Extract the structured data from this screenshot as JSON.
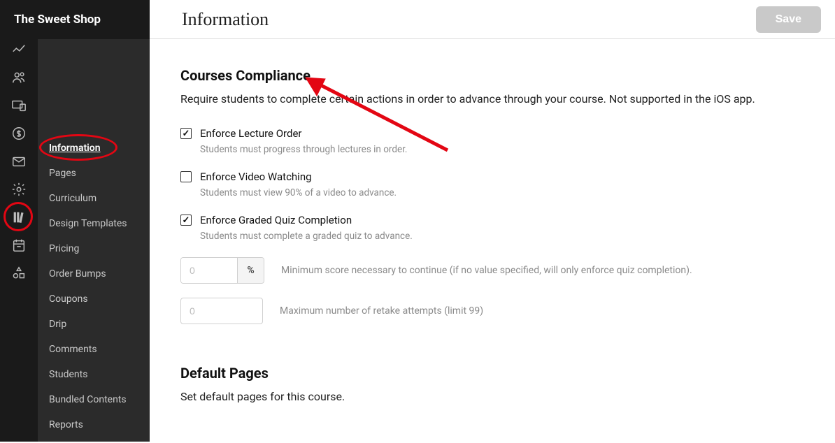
{
  "brand": "The Sweet Shop",
  "subnav": {
    "items": [
      {
        "label": "Information",
        "active": true
      },
      {
        "label": "Pages"
      },
      {
        "label": "Curriculum"
      },
      {
        "label": "Design Templates"
      },
      {
        "label": "Pricing"
      },
      {
        "label": "Order Bumps"
      },
      {
        "label": "Coupons"
      },
      {
        "label": "Drip"
      },
      {
        "label": "Comments"
      },
      {
        "label": "Students"
      },
      {
        "label": "Bundled Contents"
      },
      {
        "label": "Reports"
      }
    ]
  },
  "topbar": {
    "title": "Information",
    "save_label": "Save"
  },
  "compliance": {
    "title": "Courses Compliance",
    "desc": "Require students to complete certain actions in order to advance through your course. Not supported in the iOS app.",
    "items": [
      {
        "label": "Enforce Lecture Order",
        "help": "Students must progress through lectures in order.",
        "checked": true
      },
      {
        "label": "Enforce Video Watching",
        "help": "Students must view 90% of a video to advance.",
        "checked": false
      },
      {
        "label": "Enforce Graded Quiz Completion",
        "help": "Students must complete a graded quiz to advance.",
        "checked": true
      }
    ],
    "min_score": {
      "placeholder": "0",
      "suffix": "%",
      "help": "Minimum score necessary to continue (if no value specified, will only enforce quiz completion)."
    },
    "retakes": {
      "placeholder": "0",
      "help": "Maximum number of retake attempts (limit 99)"
    }
  },
  "default_pages": {
    "title": "Default Pages",
    "desc": "Set default pages for this course."
  }
}
